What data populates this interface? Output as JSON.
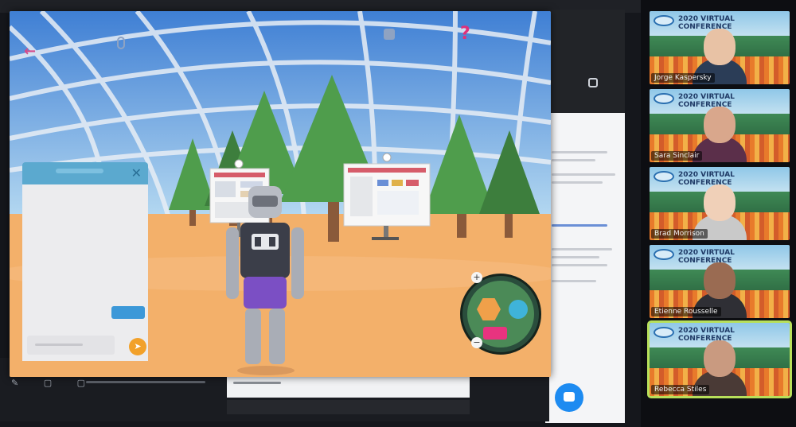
{
  "vr_app": {
    "chat": {},
    "minimap": {}
  },
  "participants": [
    {
      "name": "Jorge Kaspersky",
      "conference_title": "2020 VIRTUAL",
      "conference_sub": "CONFERENCE",
      "skin": "#e8c2a5",
      "shirt": "#2b3d57",
      "active": false
    },
    {
      "name": "Sara Sinclair",
      "conference_title": "2020 VIRTUAL",
      "conference_sub": "CONFERENCE",
      "skin": "#d9a78c",
      "shirt": "#5b2f4a",
      "active": false
    },
    {
      "name": "Brad Morrison",
      "conference_title": "2020 VIRTUAL",
      "conference_sub": "CONFERENCE",
      "skin": "#f0d0b8",
      "shirt": "#c9c9c9",
      "active": false
    },
    {
      "name": "Etienne Rousselle",
      "conference_title": "2020 VIRTUAL",
      "conference_sub": "CONFERENCE",
      "skin": "#9a6b52",
      "shirt": "#2f2f35",
      "active": false
    },
    {
      "name": "Rebecca Stiles",
      "conference_title": "2020 VIRTUAL",
      "conference_sub": "CONFERENCE",
      "skin": "#c99a80",
      "shirt": "#4a3a36",
      "active": true
    }
  ],
  "colors": {
    "sky_top": "#3f7fd4",
    "sky_bottom": "#b9dcf2",
    "floor": "#f3b06a",
    "tree": "#4f9d4c",
    "tree_dark": "#3d7e3d",
    "accent_pink": "#e0317a",
    "accent_blue": "#3c98d8",
    "send_orange": "#f2a12a",
    "active_speaker": "#b8e05a"
  }
}
